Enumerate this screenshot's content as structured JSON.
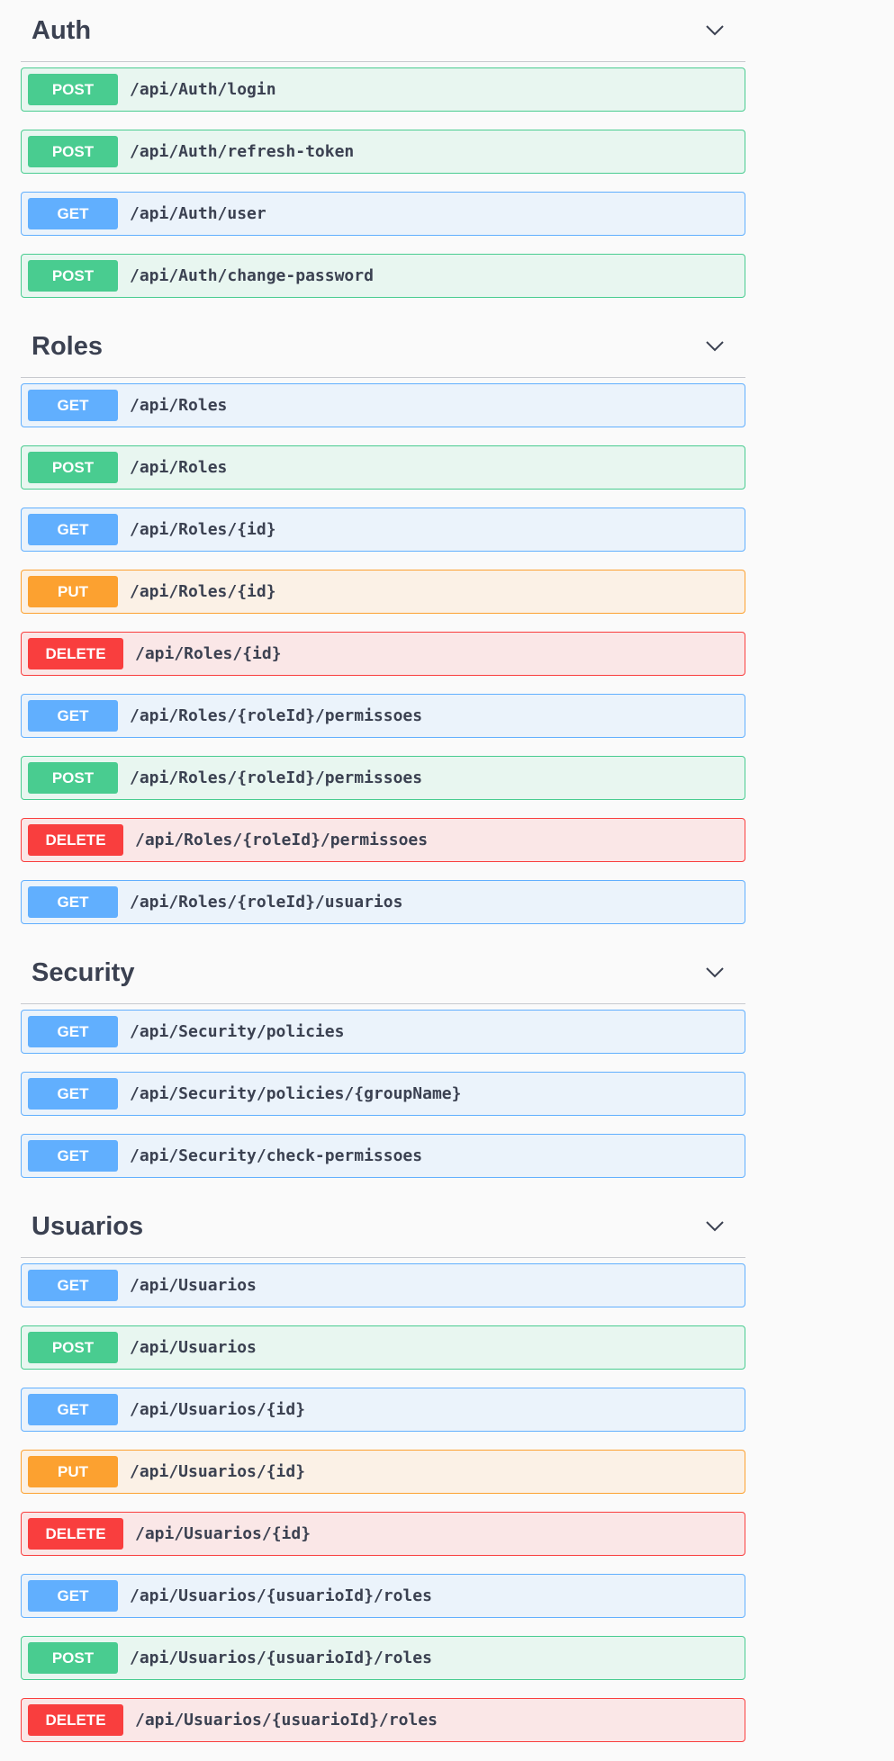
{
  "sections": [
    {
      "title": "Auth",
      "operations": [
        {
          "method": "POST",
          "path": "/api/Auth/login"
        },
        {
          "method": "POST",
          "path": "/api/Auth/refresh-token"
        },
        {
          "method": "GET",
          "path": "/api/Auth/user"
        },
        {
          "method": "POST",
          "path": "/api/Auth/change-password"
        }
      ]
    },
    {
      "title": "Roles",
      "operations": [
        {
          "method": "GET",
          "path": "/api/Roles"
        },
        {
          "method": "POST",
          "path": "/api/Roles"
        },
        {
          "method": "GET",
          "path": "/api/Roles/{id}"
        },
        {
          "method": "PUT",
          "path": "/api/Roles/{id}"
        },
        {
          "method": "DELETE",
          "path": "/api/Roles/{id}"
        },
        {
          "method": "GET",
          "path": "/api/Roles/{roleId}/permissoes"
        },
        {
          "method": "POST",
          "path": "/api/Roles/{roleId}/permissoes"
        },
        {
          "method": "DELETE",
          "path": "/api/Roles/{roleId}/permissoes"
        },
        {
          "method": "GET",
          "path": "/api/Roles/{roleId}/usuarios"
        }
      ]
    },
    {
      "title": "Security",
      "operations": [
        {
          "method": "GET",
          "path": "/api/Security/policies"
        },
        {
          "method": "GET",
          "path": "/api/Security/policies/{groupName}"
        },
        {
          "method": "GET",
          "path": "/api/Security/check-permissoes"
        }
      ]
    },
    {
      "title": "Usuarios",
      "operations": [
        {
          "method": "GET",
          "path": "/api/Usuarios"
        },
        {
          "method": "POST",
          "path": "/api/Usuarios"
        },
        {
          "method": "GET",
          "path": "/api/Usuarios/{id}"
        },
        {
          "method": "PUT",
          "path": "/api/Usuarios/{id}"
        },
        {
          "method": "DELETE",
          "path": "/api/Usuarios/{id}"
        },
        {
          "method": "GET",
          "path": "/api/Usuarios/{usuarioId}/roles"
        },
        {
          "method": "POST",
          "path": "/api/Usuarios/{usuarioId}/roles"
        },
        {
          "method": "DELETE",
          "path": "/api/Usuarios/{usuarioId}/roles"
        }
      ]
    }
  ],
  "icons": {
    "collapse": "chevron-down-icon"
  },
  "colors": {
    "get": "#61affe",
    "post": "#49cc90",
    "put": "#fca130",
    "delete": "#f93e3e",
    "title": "#3b4151"
  }
}
